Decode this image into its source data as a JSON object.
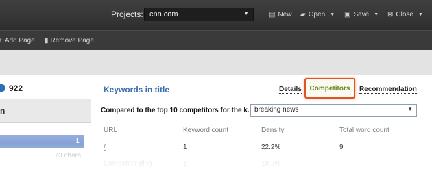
{
  "topbar": {
    "projects_label": "Projects:",
    "project_value": "cnn.com",
    "new_label": "New",
    "open_label": "Open",
    "save_label": "Save",
    "close_label": "Close"
  },
  "subbar": {
    "add_page_label": "Add Page",
    "remove_page_label": "Remove Page"
  },
  "left": {
    "score": "922",
    "header_partial": "n",
    "selected_value": "1",
    "chars": "73 chars"
  },
  "main": {
    "title": "Keywords in title",
    "tabs": {
      "details": "Details",
      "competitors": "Competitors",
      "recommendation": "Recommendation"
    },
    "compare_label": "Compared to the top 10 competitors for the k...",
    "keyword_value": "breaking news",
    "columns": [
      "URL",
      "Keyword count",
      "Density",
      "Total word count"
    ],
    "rows": [
      {
        "url": "/",
        "count": "1",
        "density": "22.2%",
        "total": "9"
      },
      {
        "url": "Competitor ding",
        "count": "1",
        "density": "18.2%",
        "total": ""
      }
    ]
  },
  "colors": {
    "accent": "#3b6eb0",
    "highlight_border": "#dd5422",
    "competitors_text": "#6b8a1f"
  }
}
